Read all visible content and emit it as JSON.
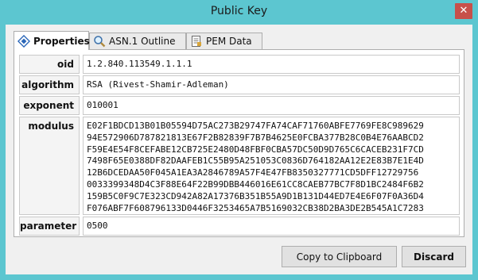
{
  "window": {
    "title": "Public Key",
    "close_glyph": "✕"
  },
  "tabs": [
    {
      "label": "Properties",
      "icon": "properties-icon",
      "active": true
    },
    {
      "label": "ASN.1 Outline",
      "icon": "magnifier-icon",
      "active": false
    },
    {
      "label": "PEM Data",
      "icon": "document-icon",
      "active": false
    }
  ],
  "fields": {
    "oid": {
      "label": "oid",
      "value": "1.2.840.113549.1.1.1"
    },
    "algorithm": {
      "label": "algorithm",
      "value": "RSA (Rivest-Shamir-Adleman)"
    },
    "exponent": {
      "label": "exponent",
      "value": "010001"
    },
    "modulus": {
      "label": "modulus",
      "lines": [
        "E02F1BDCD13B01B05594D75AC273B29747FA74CAF71760ABFE7769FE8C989629",
        "94E572906D787821813E67F2B82839F7B7B4625E0FCBA377B28C0B4E76AABCD2",
        "F59E4E54F8CEFABE12CB725E2480D48FBF0CBA57DC50D9D765C6CACEB231F7CD",
        "7498F65E0388DF82DAAFEB1C55B95A251053C0836D764182AA12E2E83B7E1E4D",
        "12B6DCEDAA50F045A1EA3A2846789A57F4E47FB8350327771CD5DFF12729756",
        "0033399348D4C3F88E64F22B99DBB446016E61CC8CAEB77BC7F8D1BC2484F6B2",
        "159B5C0F9C7E323CD942A82A17376B351B55A9D1B131D44ED7E4E6F07F0A36D4",
        "F076ABF7F608796133D0446F3253465A7B5169032CB38D2BA3DE2B545A1C7283"
      ]
    },
    "parameter": {
      "label": "parameter",
      "value": "0500"
    }
  },
  "buttons": {
    "copy_label": "Copy to Clipboard",
    "discard_label": "Discard"
  },
  "colors": {
    "frame": "#5cc6d0",
    "close": "#c7504a",
    "client": "#f0f0f0"
  }
}
